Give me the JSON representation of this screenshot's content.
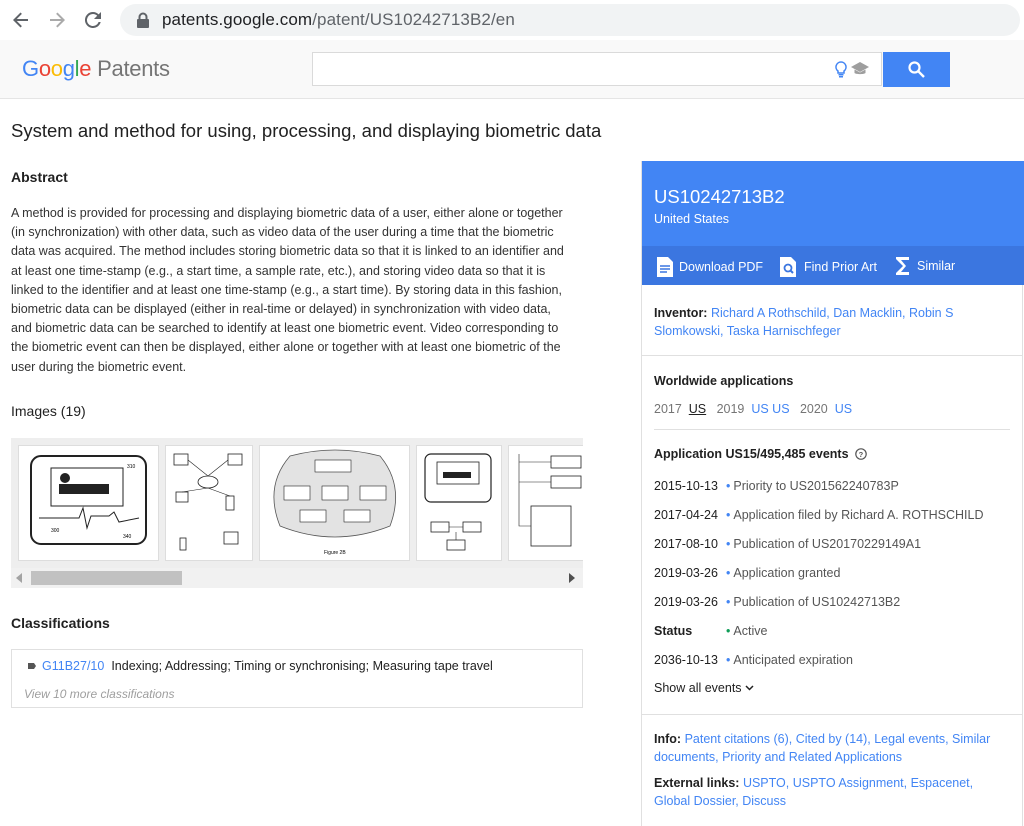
{
  "browser": {
    "url_host": "patents.google.com",
    "url_path": "/patent/US10242713B2/en"
  },
  "header": {
    "logo_google": "Google",
    "logo_patents": "Patents",
    "search_value": ""
  },
  "patent": {
    "title": "System and method for using, processing, and displaying biometric data",
    "abstract_heading": "Abstract",
    "abstract": "A method is provided for processing and displaying biometric data of a user, either alone or together (in synchronization) with other data, such as video data of the user during a time that the biometric data was acquired. The method includes storing biometric data so that it is linked to an identifier and at least one time-stamp (e.g., a start time, a sample rate, etc.), and storing video data so that it is linked to the identifier and at least one time-stamp (e.g., a start time). By storing data in this fashion, biometric data can be displayed (either in real-time or delayed) in synchronization with video data, and biometric data can be searched to identify at least one biometric event. Video corresponding to the biometric event can then be displayed, either alone or together with at least one biometric of the user during the biometric event.",
    "images_heading": "Images (19)",
    "classifications_heading": "Classifications",
    "classification": {
      "code": "G11B27/10",
      "description": "Indexing; Addressing; Timing or synchronising; Measuring tape travel"
    },
    "view_more": "View 10 more classifications"
  },
  "sidebar": {
    "pub_number": "US10242713B2",
    "country": "United States",
    "actions": {
      "download": "Download PDF",
      "prior_art": "Find Prior Art",
      "similar": "Similar"
    },
    "inventor_label": "Inventor:",
    "inventors": "Richard A Rothschild, Dan Macklin, Robin S Slomkowski, Taska Harnischfeger",
    "worldwide_heading": "Worldwide applications",
    "worldwide": {
      "y1": "2017",
      "y1_links": "US",
      "y2": "2019",
      "y2_links": "US US",
      "y3": "2020",
      "y3_links": "US"
    },
    "application_heading": "Application US15/495,485 events",
    "events": [
      {
        "date": "2015-10-13",
        "text": "Priority to US201562240783P"
      },
      {
        "date": "2017-04-24",
        "text": "Application filed by Richard A. ROTHSCHILD"
      },
      {
        "date": "2017-08-10",
        "text": "Publication of US20170229149A1"
      },
      {
        "date": "2019-03-26",
        "text": "Application granted"
      },
      {
        "date": "2019-03-26",
        "text": "Publication of US10242713B2"
      },
      {
        "date": "Status",
        "text": "Active"
      },
      {
        "date": "2036-10-13",
        "text": "Anticipated expiration"
      }
    ],
    "show_all": "Show all events",
    "info_label": "Info:",
    "info_links": "Patent citations (6), Cited by (14), Legal events, Similar documents, Priority and Related Applications",
    "external_label": "External links:",
    "external_links": "USPTO, USPTO Assignment, Espacenet, Global Dossier, Discuss"
  },
  "colors": {
    "accent": "#4285f4",
    "accent_dark": "#3b76e0",
    "status_green": "#0f9d58"
  }
}
